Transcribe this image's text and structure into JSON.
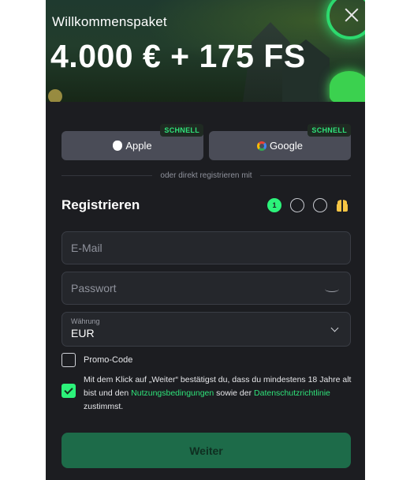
{
  "banner": {
    "subtitle": "Willkommenspaket",
    "title": "4.000 € + 175 FS"
  },
  "social": {
    "apple_label": "Apple",
    "google_label": "Google",
    "badge": "SCHNELL"
  },
  "divider_text": "oder direkt registrieren mit",
  "registration": {
    "title": "Registrieren",
    "steps": [
      "1",
      "",
      ""
    ],
    "current_step": 1
  },
  "form": {
    "email_placeholder": "E-Mail",
    "password_placeholder": "Passwort",
    "currency_label": "Währung",
    "currency_value": "EUR"
  },
  "promo_label": "Promo-Code",
  "terms": {
    "text_before": "Mit dem Klick auf „Weiter“ bestätigst du, dass du mindestens 18 Jahre alt bist und den ",
    "link1": "Nutzungsbedingungen",
    "text_middle": " sowie der ",
    "link2": "Datenschutzrichtlinie",
    "text_after": " zustimmst.",
    "checked": true
  },
  "submit_label": "Weiter",
  "colors": {
    "accent": "#2cf27a",
    "background": "#1c1d21",
    "button": "#1d6b49"
  }
}
